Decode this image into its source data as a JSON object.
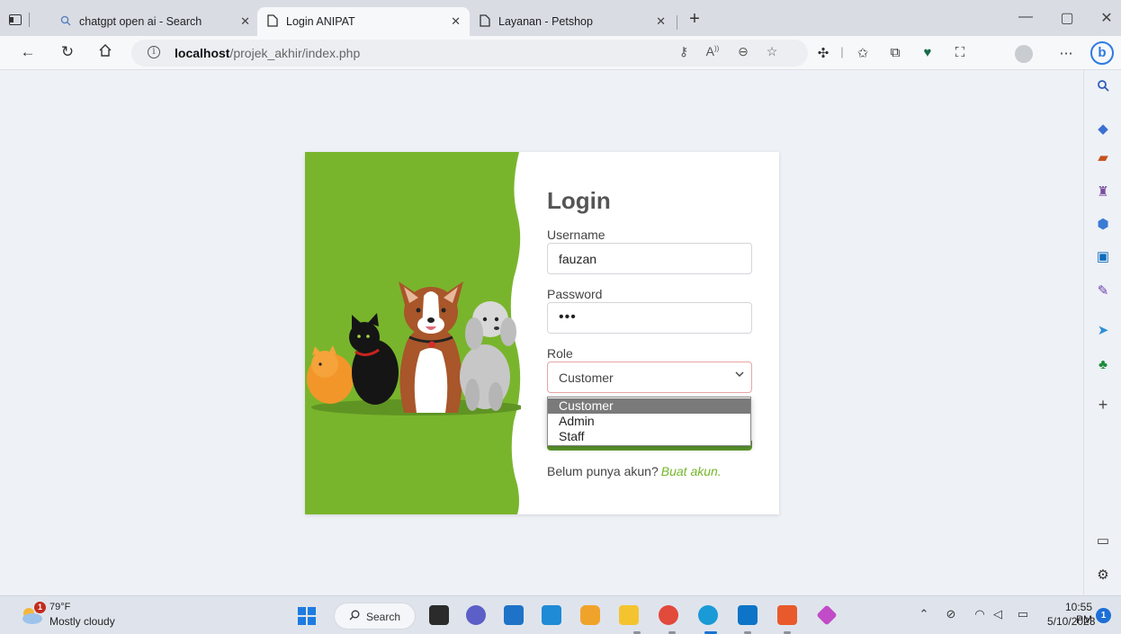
{
  "browser": {
    "tabs": [
      {
        "title": "chatgpt open ai - Search",
        "icon": "search-icon"
      },
      {
        "title": "Login ANIPAT",
        "icon": "page-icon"
      },
      {
        "title": "Layanan - Petshop",
        "icon": "page-icon"
      }
    ],
    "active_tab": 1,
    "address": {
      "host": "localhost",
      "path": "/projek_akhir/index.php"
    },
    "new_tab_glyph": "+",
    "window_controls": [
      "—",
      "▢",
      "✕"
    ]
  },
  "login": {
    "title": "Login",
    "username_label": "Username",
    "username_value": "fauzan",
    "password_label": "Password",
    "password_dots": "•••",
    "role_label": "Role",
    "role_selected": "Customer",
    "role_options": [
      "Customer",
      "Admin",
      "Staff"
    ],
    "signup_text": "Belum punya akun?",
    "signup_link": "Buat akun."
  },
  "colors": {
    "panel_green": "#79b52c",
    "accent_green": "#74b62c",
    "button_green": "#5d9a2e",
    "select_border": "#e8a4a4"
  },
  "taskbar": {
    "weather_temp": "79°F",
    "weather_desc": "Mostly cloudy",
    "weather_badge": "1",
    "search_label": "Search",
    "time": "10:55 PM",
    "date": "5/10/2023",
    "notification_count": "1"
  }
}
